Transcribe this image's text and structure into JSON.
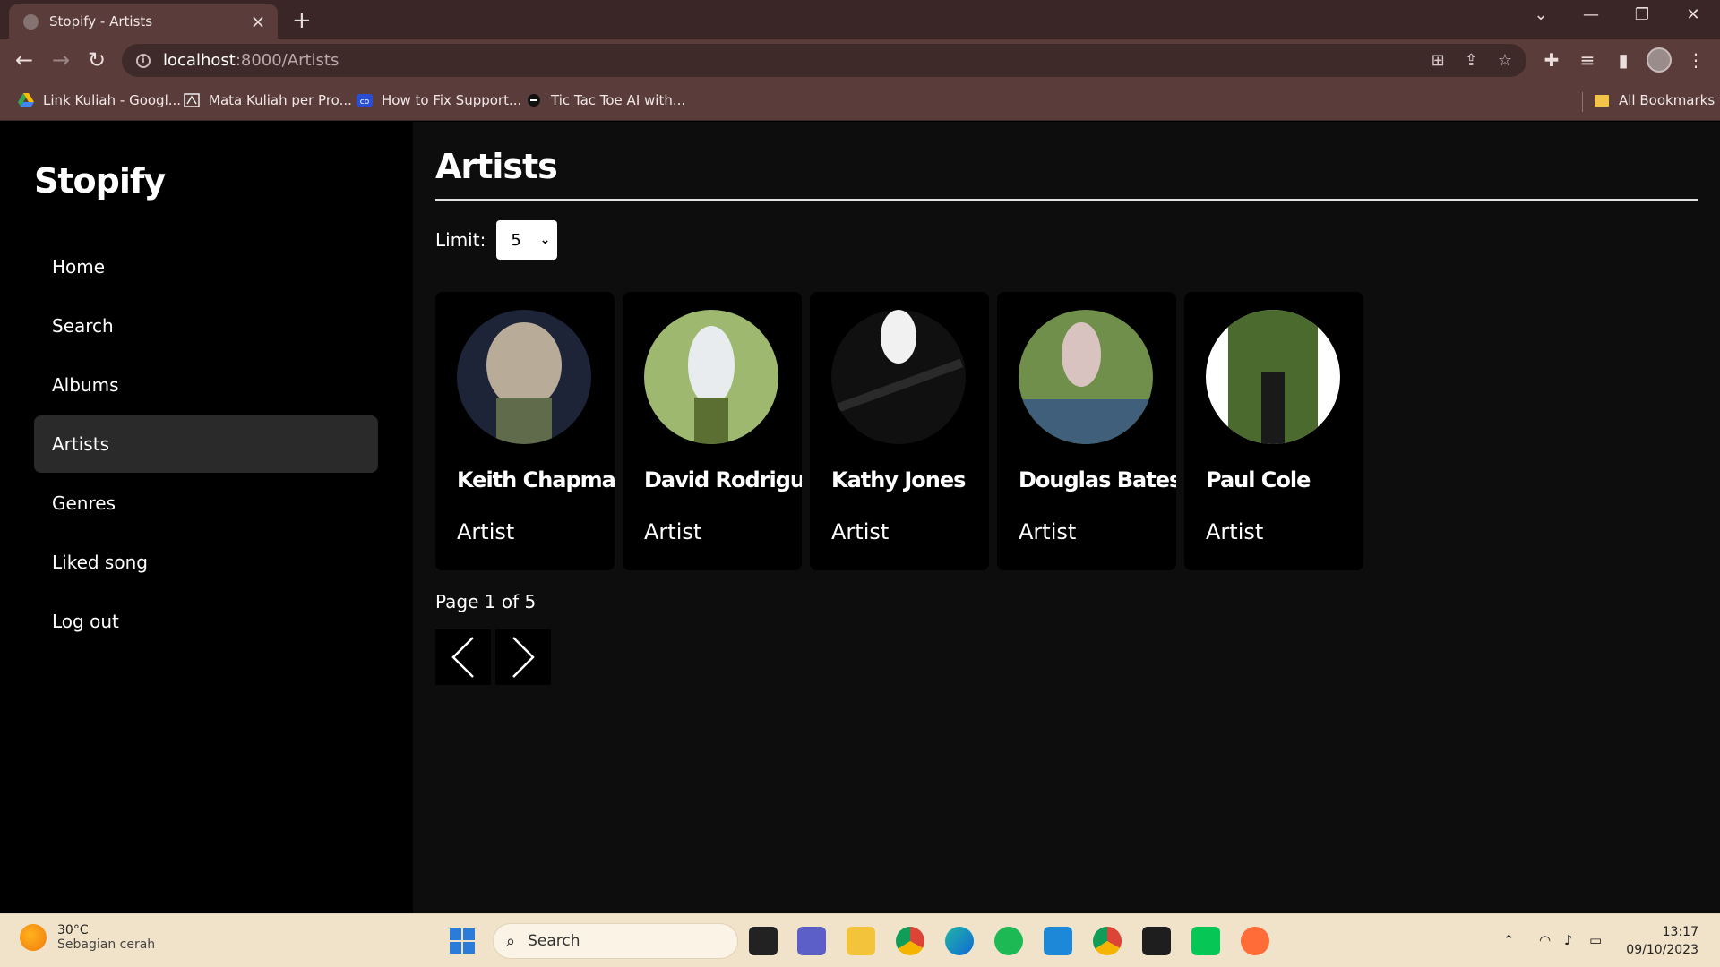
{
  "browser": {
    "tab_title": "Stopify - Artists",
    "url_host": "localhost",
    "url_path": ":8000/Artists",
    "bookmarks": [
      {
        "label": "Link Kuliah - Googl...",
        "icon": "google-drive-icon"
      },
      {
        "label": "Mata Kuliah per Pro...",
        "icon": "bookmark-favicon-icon"
      },
      {
        "label": "How to Fix Support...",
        "icon": "co-favicon-icon"
      },
      {
        "label": "Tic Tac Toe AI with...",
        "icon": "tictactoe-favicon-icon"
      }
    ],
    "all_bookmarks": "All Bookmarks"
  },
  "app": {
    "logo": "Stopify",
    "nav": [
      {
        "label": "Home",
        "active": false
      },
      {
        "label": "Search",
        "active": false
      },
      {
        "label": "Albums",
        "active": false
      },
      {
        "label": "Artists",
        "active": true
      },
      {
        "label": "Genres",
        "active": false
      },
      {
        "label": "Liked song",
        "active": false
      },
      {
        "label": "Log out",
        "active": false
      }
    ],
    "page_title": "Artists",
    "limit_label": "Limit:",
    "limit_value": "5",
    "artists": [
      {
        "name": "Keith Chapman",
        "role": "Artist",
        "colors": [
          "#1d2438",
          "#b8ab98",
          "#5f6b4a"
        ]
      },
      {
        "name": "David Rodriguez",
        "role": "Artist",
        "colors": [
          "#9eb96f",
          "#e8ecef",
          "#5c6f33"
        ]
      },
      {
        "name": "Kathy Jones",
        "role": "Artist",
        "colors": [
          "#101010",
          "#f1f1f1",
          "#2a2a2a"
        ]
      },
      {
        "name": "Douglas Bates",
        "role": "Artist",
        "colors": [
          "#6f8f4a",
          "#d9c3c0",
          "#3f5f7a"
        ]
      },
      {
        "name": "Paul Cole",
        "role": "Artist",
        "colors": [
          "#ffffff",
          "#4b6a2d",
          "#1a1a1a"
        ]
      }
    ],
    "page_info": "Page 1 of 5"
  },
  "taskbar": {
    "weather_temp": "30°C",
    "weather_desc": "Sebagian cerah",
    "search_label": "Search",
    "time": "13:17",
    "date": "09/10/2023"
  }
}
